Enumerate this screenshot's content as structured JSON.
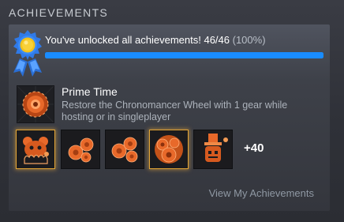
{
  "section": {
    "title": "ACHIEVEMENTS"
  },
  "summary": {
    "text": "You've unlocked all achievements! 46/46",
    "percent_text": "(100%)",
    "progress": 1.0,
    "medal_icon": "blue-ribbon-gold-medal-icon"
  },
  "featured": {
    "title": "Prime Time",
    "description": "Restore the Chronomancer Wheel with 1 gear while hosting or in singleplayer",
    "icon": "chronomancer-wheel-icon"
  },
  "recent": [
    {
      "icon": "orange-creature-group-icon",
      "rare": true
    },
    {
      "icon": "orange-gears-icon",
      "rare": false
    },
    {
      "icon": "orange-gears-icon",
      "rare": false
    },
    {
      "icon": "orange-gear-burst-icon",
      "rare": true
    },
    {
      "icon": "orange-robot-hat-icon",
      "rare": false
    }
  ],
  "more_count": "+40",
  "view_link": "View My Achievements",
  "colors": {
    "progress": "#1a8cff",
    "achievement_orange": "#e8692a",
    "rare_glow": "#e3a535"
  }
}
